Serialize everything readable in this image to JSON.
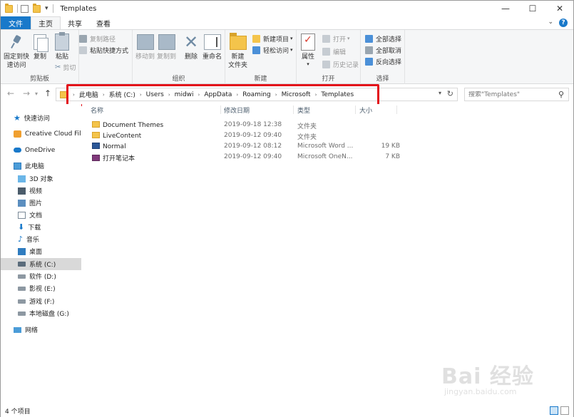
{
  "window": {
    "title": "Templates",
    "controls": [
      "—",
      "☐",
      "✕"
    ]
  },
  "ribbon_tabs": [
    {
      "label": "文件"
    },
    {
      "label": "主页"
    },
    {
      "label": "共享"
    },
    {
      "label": "查看"
    }
  ],
  "ribbon": {
    "clipboard": {
      "pin_label_1": "固定到快",
      "pin_label_2": "速访问",
      "copy_label": "复制",
      "paste_label": "粘贴",
      "copy_path_label": "复制路径",
      "paste_shortcut_label": "粘贴快捷方式",
      "cut_label": "剪切",
      "group_label": "剪贴板"
    },
    "organize": {
      "move_to_label": "移动到",
      "copy_to_label": "复制到",
      "delete_label": "删除",
      "rename_label": "重命名",
      "group_label": "组织"
    },
    "new": {
      "new_folder_label_1": "新建",
      "new_folder_label_2": "文件夹",
      "new_item_label": "新建项目",
      "easy_access_label": "轻松访问",
      "group_label": "新建"
    },
    "open": {
      "properties_label": "属性",
      "open_label": "打开",
      "edit_label": "编辑",
      "history_label": "历史记录",
      "group_label": "打开"
    },
    "select": {
      "select_all_label": "全部选择",
      "select_none_label": "全部取消",
      "invert_label": "反向选择",
      "group_label": "选择"
    }
  },
  "address": {
    "crumbs": [
      "此电脑",
      "系统 (C:)",
      "Users",
      "midwi",
      "AppData",
      "Roaming",
      "Microsoft",
      "Templates"
    ],
    "search_placeholder": "搜索\"Templates\""
  },
  "nav_pane": {
    "items": [
      {
        "label": "快速访问",
        "icon": "star-icon"
      },
      {
        "label": "Creative Cloud Files",
        "icon": "creative-cloud-icon"
      },
      {
        "label": "OneDrive",
        "icon": "onedrive-icon"
      },
      {
        "label": "此电脑",
        "icon": "this-pc-icon"
      },
      {
        "label": "3D 对象",
        "icon": "3d-objects-icon"
      },
      {
        "label": "视频",
        "icon": "videos-icon"
      },
      {
        "label": "图片",
        "icon": "pictures-icon"
      },
      {
        "label": "文档",
        "icon": "documents-icon"
      },
      {
        "label": "下载",
        "icon": "downloads-icon"
      },
      {
        "label": "音乐",
        "icon": "music-icon"
      },
      {
        "label": "桌面",
        "icon": "desktop-icon"
      },
      {
        "label": "系统 (C:)",
        "icon": "drive-icon"
      },
      {
        "label": "软件 (D:)",
        "icon": "drive-icon"
      },
      {
        "label": "影视 (E:)",
        "icon": "drive-icon"
      },
      {
        "label": "游戏 (F:)",
        "icon": "drive-icon"
      },
      {
        "label": "本地磁盘 (G:)",
        "icon": "drive-icon"
      },
      {
        "label": "网络",
        "icon": "network-icon"
      }
    ],
    "selected_index": 11
  },
  "file_list": {
    "columns": [
      "名称",
      "修改日期",
      "类型",
      "大小"
    ],
    "rows": [
      {
        "name": "Document Themes",
        "modified": "2019-09-18 12:38",
        "type": "文件夹",
        "size": "",
        "icon": "folder-icon"
      },
      {
        "name": "LiveContent",
        "modified": "2019-09-12 09:40",
        "type": "文件夹",
        "size": "",
        "icon": "folder-icon"
      },
      {
        "name": "Normal",
        "modified": "2019-09-12 08:12",
        "type": "Microsoft Word ...",
        "size": "19 KB",
        "icon": "word-document-icon"
      },
      {
        "name": "打开笔记本",
        "modified": "2019-09-12 09:40",
        "type": "Microsoft OneN...",
        "size": "7 KB",
        "icon": "onenote-icon"
      }
    ]
  },
  "status": {
    "item_count": "4 个项目"
  },
  "watermark": {
    "brand": "Bai 经验",
    "url": "jingyan.baidu.com"
  },
  "colors": {
    "accent": "#1979ca",
    "highlight_box": "#e3101a",
    "folder": "#f4c44b"
  }
}
